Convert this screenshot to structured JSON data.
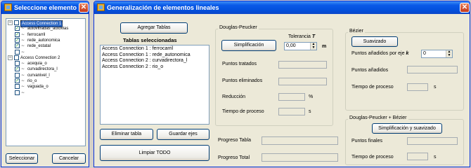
{
  "dialog": {
    "title": "Seleccione  elemento lineal",
    "close": "✕",
    "tree": [
      {
        "level": 0,
        "expander": "−",
        "checked": false,
        "label": "Access Connection 1",
        "selected": true
      },
      {
        "level": 1,
        "checked": true,
        "label": "autovitradas_autovias"
      },
      {
        "level": 1,
        "checked": true,
        "label": "ferrocarril"
      },
      {
        "level": 1,
        "checked": true,
        "label": "rede_autonomica"
      },
      {
        "level": 1,
        "checked": true,
        "label": "rede_estatal"
      },
      {
        "level": 1,
        "checked": false,
        "label": ""
      },
      {
        "level": 0,
        "expander": "−",
        "checked": false,
        "label": "Access Connection 2"
      },
      {
        "level": 1,
        "checked": false,
        "label": "acequia_o"
      },
      {
        "level": 1,
        "checked": true,
        "label": "curvadirectora_l"
      },
      {
        "level": 1,
        "checked": false,
        "label": "curvanivel_l"
      },
      {
        "level": 1,
        "checked": true,
        "label": "rio_o"
      },
      {
        "level": 1,
        "checked": false,
        "label": "vaguada_o"
      },
      {
        "level": 1,
        "checked": false,
        "label": ""
      }
    ],
    "select_button": "Seleccionar",
    "cancel_button": "Cancelar"
  },
  "main": {
    "title": "Generalización de elementos lineales",
    "close": "✕",
    "add_tables_button": "Agregar Tablas",
    "selected_tables_label": "Tablas seleccionadas",
    "selected_tables": [
      "Access Connection 1 : ferrocarril",
      "Access Connection 1 : rede_autonomica",
      "Access Connection 2 : curvadirectora_l",
      "Access Connection 2 : rio_o"
    ],
    "delete_table_button": "Eliminar tabla",
    "save_axes_button": "Guardar ejes",
    "clear_all_button": "Limpiar TODO",
    "douglas": {
      "group_label": "Douglas-Peucker",
      "tolerance_label": "Tolerancia",
      "tolerance_symbol": "T",
      "simplify_button": "Simplificación",
      "tolerance_value": "0,00",
      "unit_m": "m",
      "processed_points_label": "Puntos tratados",
      "removed_points_label": "Puntos eliminados",
      "reduction_label": "Reducción",
      "percent": "%",
      "process_time_label": "Tiempo de proceso",
      "seconds": "s"
    },
    "bezier": {
      "group_label": "Bézier",
      "smooth_button": "Suavizado",
      "points_per_axis_label": "Puntos añadidos por eje",
      "k_symbol": "k",
      "points_per_axis_value": "0",
      "added_points_label": "Puntos añadidos",
      "process_time_label": "Tiempo de proceso",
      "seconds": "s"
    },
    "combined": {
      "group_label": "Douglas-Peucker + Bézier",
      "simplify_smooth_button": "Simplificación y suavizado",
      "final_points_label": "Puntos finales",
      "process_time_label": "Tiempo de proceso",
      "seconds": "s"
    },
    "progress_table_label": "Progreso Tabla",
    "progress_total_label": "Progreso Total"
  }
}
